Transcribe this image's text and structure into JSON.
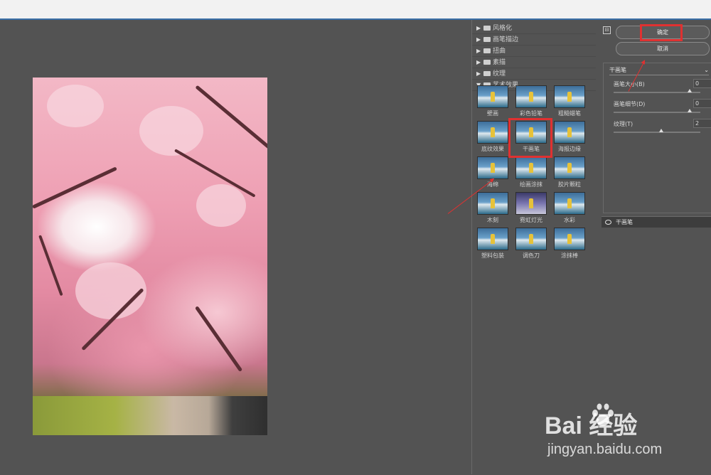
{
  "categories": [
    {
      "label": "风格化",
      "expanded": false
    },
    {
      "label": "画笔描边",
      "expanded": false
    },
    {
      "label": "扭曲",
      "expanded": false
    },
    {
      "label": "素描",
      "expanded": false
    },
    {
      "label": "纹理",
      "expanded": false
    },
    {
      "label": "艺术效果",
      "expanded": true
    }
  ],
  "filters": [
    "壁画",
    "彩色铅笔",
    "粗糙蜡笔",
    "底纹效果",
    "干画笔",
    "海报边缘",
    "海绵",
    "绘画涂抹",
    "胶片颗粒",
    "木刻",
    "霓虹灯光",
    "水彩",
    "塑料包装",
    "调色刀",
    "涂抹棒"
  ],
  "selected_filter": "干画笔",
  "buttons": {
    "ok": "确定",
    "cancel": "取消"
  },
  "settings": {
    "filter_dropdown": "干画笔",
    "params": [
      {
        "label": "画笔大小(B)",
        "value": "0"
      },
      {
        "label": "画笔细节(D)",
        "value": "0"
      },
      {
        "label": "纹理(T)",
        "value": "2"
      }
    ]
  },
  "layer": {
    "name": "干画笔"
  },
  "watermark": {
    "brand": "Bai  经验",
    "url": "jingyan.baidu.com"
  },
  "colors": {
    "highlight": "#e03131",
    "panel": "#535353"
  },
  "icons": [
    "eye-icon",
    "folder-icon",
    "triangle-right-icon",
    "triangle-down-icon",
    "chevron-down-icon",
    "paw-icon"
  ]
}
